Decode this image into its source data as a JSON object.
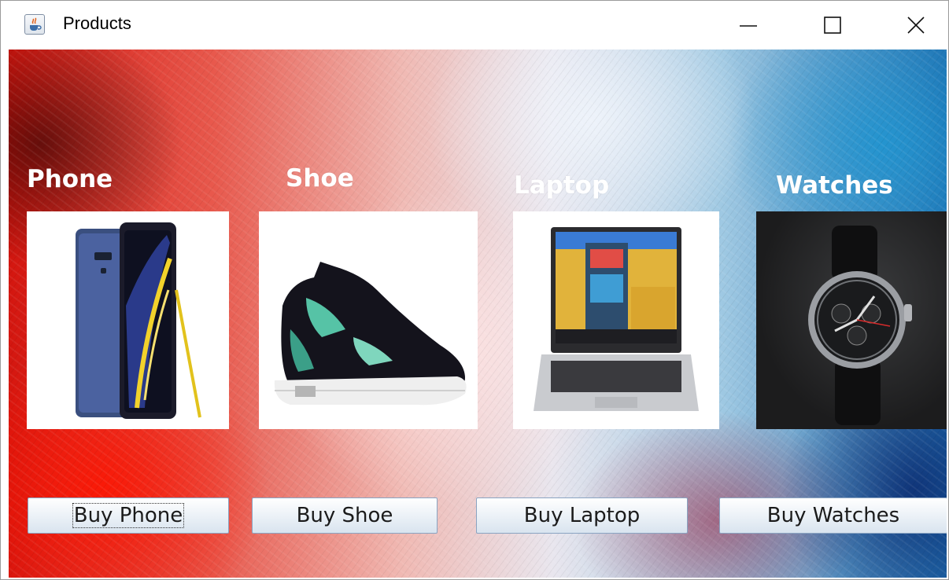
{
  "window": {
    "title": "Products",
    "icon": "java-cup-icon"
  },
  "window_controls": {
    "minimize_icon": "minimize-icon",
    "maximize_icon": "maximize-icon",
    "close_icon": "close-icon"
  },
  "products": [
    {
      "label": "Phone",
      "button": "Buy Phone",
      "image": "phone-image"
    },
    {
      "label": "Shoe",
      "button": "Buy Shoe",
      "image": "shoe-image"
    },
    {
      "label": "Laptop",
      "button": "Buy Laptop",
      "image": "laptop-image"
    },
    {
      "label": "Watches",
      "button": "Buy Watches",
      "image": "watch-image"
    }
  ],
  "colors": {
    "label_text": "#ffffff",
    "button_border": "#8aa4c2",
    "background_left": "#d4160f",
    "background_right": "#1f6fb0"
  }
}
